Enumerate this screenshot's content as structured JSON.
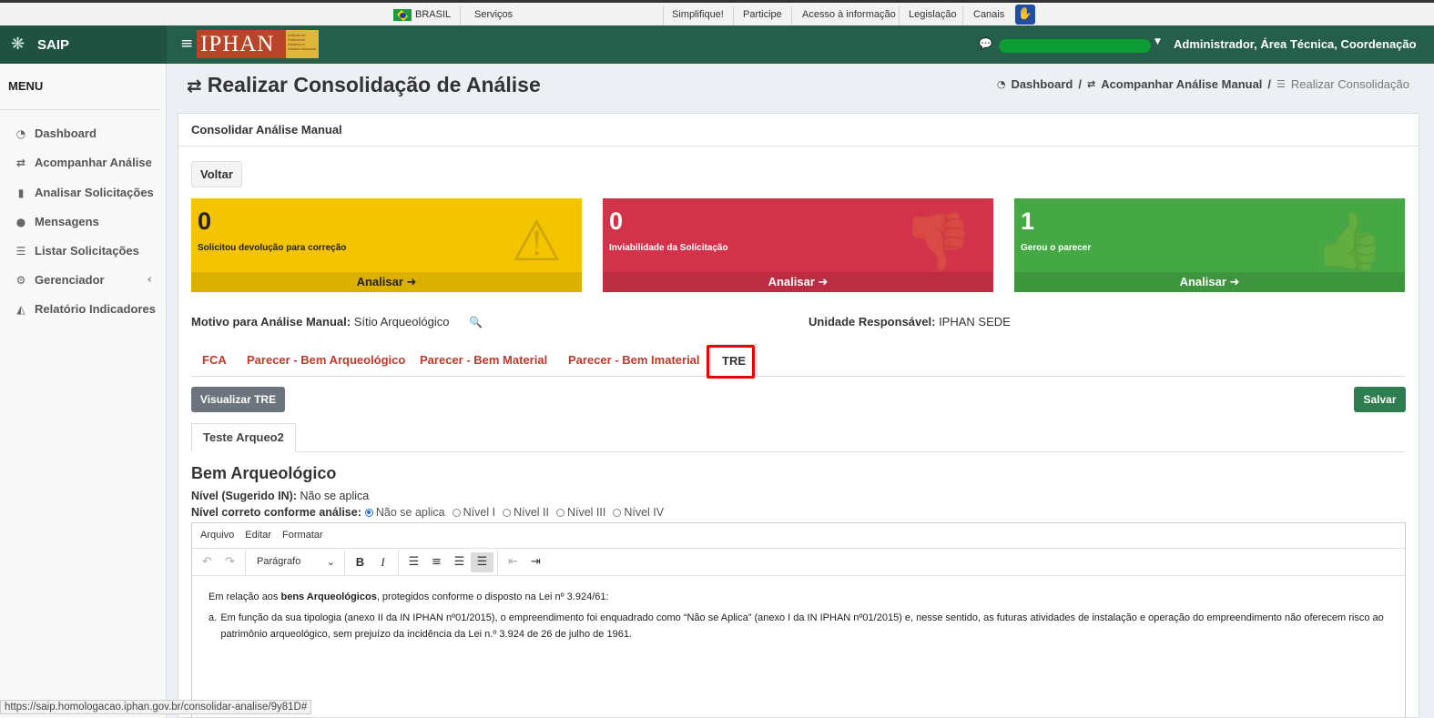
{
  "govbar": {
    "country": "BRASIL",
    "services": "Serviços",
    "links": [
      "Simplifique!",
      "Participe",
      "Acesso à informação",
      "Legislação",
      "Canais"
    ]
  },
  "header": {
    "app_name": "SAIP",
    "logo_text": "IPHAN",
    "logo_subtext": "Instituto do Patrimônio Histórico e Artístico Nacional",
    "user_roles": "Administrador, Área Técnica, Coordenação..."
  },
  "sidebar": {
    "title": "MENU",
    "items": [
      {
        "label": "Dashboard",
        "icon": "dashboard-icon"
      },
      {
        "label": "Acompanhar Análise",
        "icon": "exchange-icon"
      },
      {
        "label": "Analisar Solicitações",
        "icon": "book-icon"
      },
      {
        "label": "Mensagens",
        "icon": "comments-icon"
      },
      {
        "label": "Listar Solicitações",
        "icon": "list-icon"
      },
      {
        "label": "Gerenciador",
        "icon": "cogs-icon"
      },
      {
        "label": "Relatório Indicadores",
        "icon": "area-chart-icon"
      }
    ]
  },
  "page": {
    "title": "Realizar Consolidação de Análise",
    "breadcrumb": [
      "Dashboard",
      "Acompanhar Análise Manual",
      "Realizar Consolidação"
    ]
  },
  "panel": {
    "header": "Consolidar Análise Manual",
    "back_button": "Voltar"
  },
  "stats": [
    {
      "value": "0",
      "label": "Solicitou devolução para correção",
      "action": "Analisar",
      "color": "#f5c400",
      "icon": "warning-icon"
    },
    {
      "value": "0",
      "label": "Inviabilidade da Solicitação",
      "action": "Analisar",
      "color": "#d2334b",
      "icon": "thumbs-down-icon"
    },
    {
      "value": "1",
      "label": "Gerou o parecer",
      "action": "Analisar",
      "color": "#45a845",
      "icon": "thumbs-up-icon"
    }
  ],
  "info": {
    "motivo_label": "Motivo para Análise Manual:",
    "motivo_value": "Sítio Arqueológico",
    "unidade_label": "Unidade Responsável:",
    "unidade_value": "IPHAN SEDE"
  },
  "tabs": [
    "FCA",
    "Parecer - Bem Arqueológico",
    "Parecer - Bem Material",
    "Parecer - Bem Imaterial",
    "TRE"
  ],
  "active_tab": "TRE",
  "actions": {
    "visualizar": "Visualizar TRE",
    "salvar": "Salvar"
  },
  "subtab": "Teste Arqueo2",
  "section": {
    "title": "Bem Arqueológico",
    "nivel_sugerido_label": "Nível (Sugerido IN):",
    "nivel_sugerido_value": "Não se aplica",
    "nivel_correto_label": "Nível correto conforme análise:",
    "nivel_options": [
      "Não se aplica",
      "Nível I",
      "Nível II",
      "Nível III",
      "Nível IV"
    ],
    "nivel_selected": "Não se aplica"
  },
  "editor": {
    "menu": [
      "Arquivo",
      "Editar",
      "Formatar"
    ],
    "block_format": "Parágrafo",
    "para_prefix": "Em relação aos ",
    "para_bold": "bens Arqueológicos",
    "para_suffix": ", protegidos conforme o disposto na Lei nº 3.924/61:",
    "list_marker": "a.",
    "list_text": "Em função da sua tipologia (anexo II da IN IPHAN nº01/2015), o empreendimento foi enquadrado como “Não se Aplica” (anexo I da IN IPHAN nº01/2015) e, nesse sentido, as futuras atividades de instalação e operação do empreendimento não oferecem risco ao patrimônio arqueológico, sem prejuízo da incidência da Lei n.º 3.924 de 26 de julho de 1961."
  },
  "status_url": "https://saip.homologacao.iphan.gov.br/consolidar-analise/9y81D#"
}
